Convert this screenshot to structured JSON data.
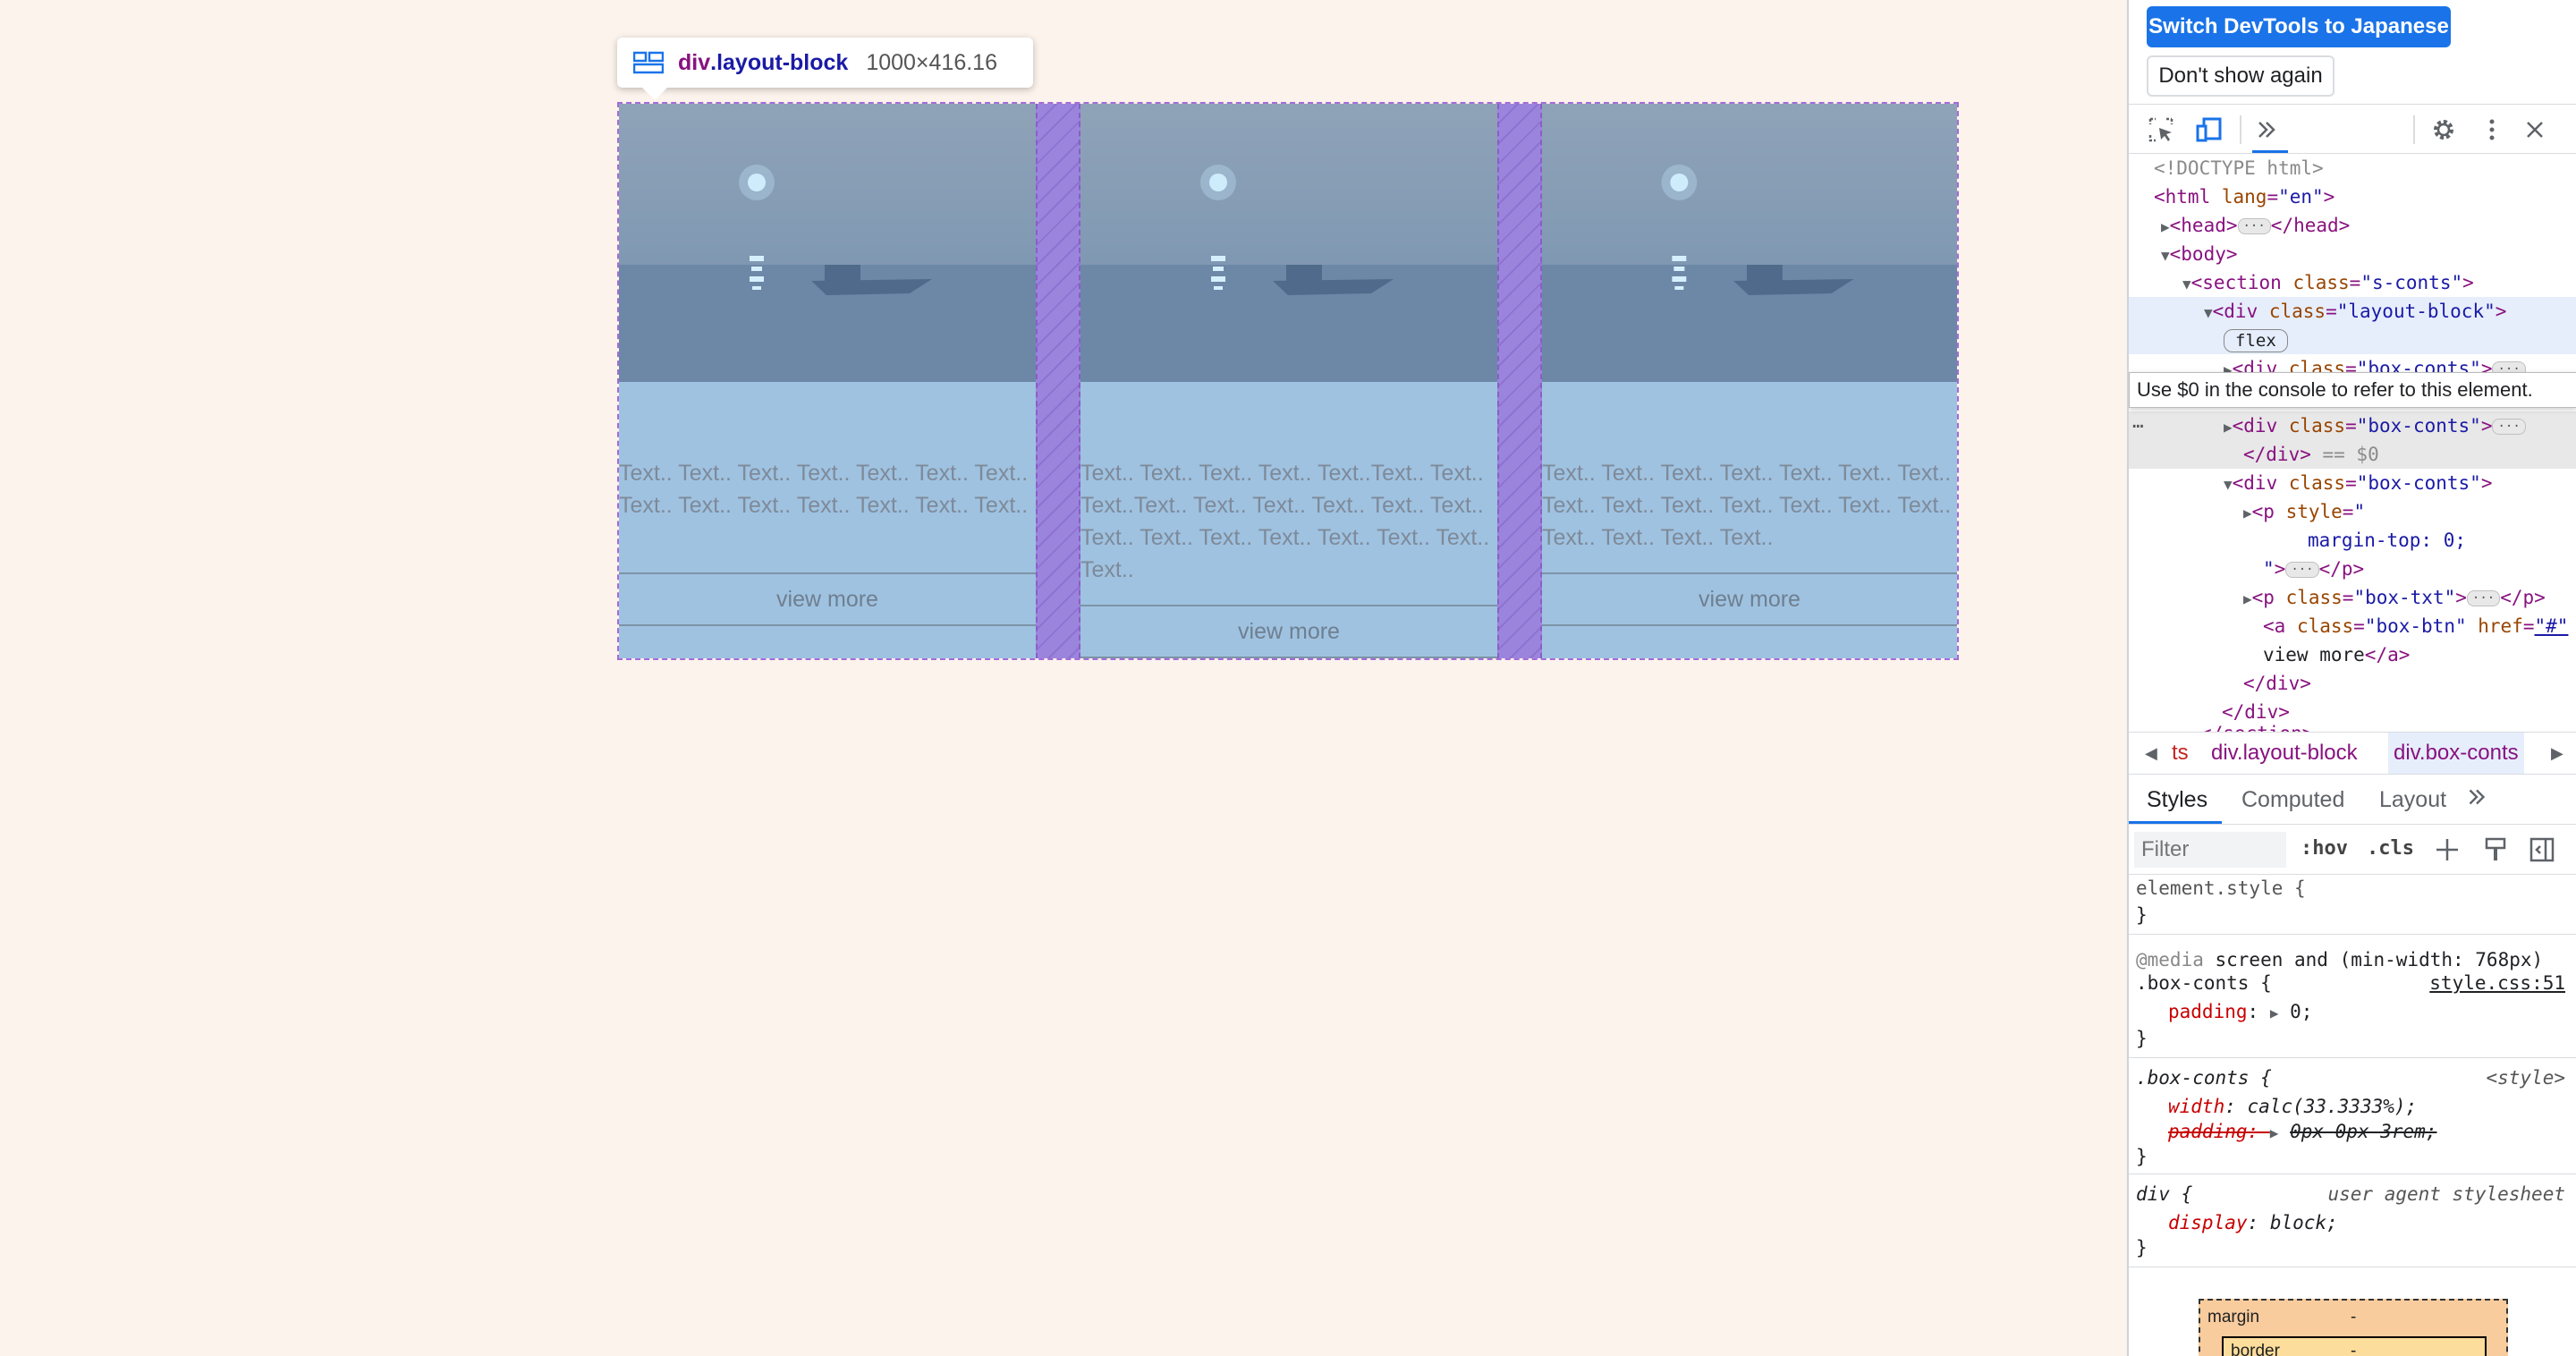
{
  "tooltip": {
    "tag": "div",
    "class": ".layout-block",
    "size": "1000×416.16"
  },
  "boxes": [
    {
      "text": "Text.. Text.. Text.. Text.. Text.. Text.. Text.. Text.. Text.. Text.. Text.. Text.. Text.. Text..",
      "button": "view more"
    },
    {
      "text": "Text.. Text.. Text.. Text.. Text..Text.. Text.. Text..Text.. Text.. Text.. Text.. Text.. Text.. Text.. Text.. Text.. Text.. Text.. Text.. Text.. Text..",
      "button": "view more"
    },
    {
      "text": "Text.. Text.. Text.. Text.. Text.. Text.. Text.. Text.. Text.. Text.. Text.. Text.. Text.. Text.. Text.. Text.. Text.. Text..",
      "button": "view more"
    }
  ],
  "devtools": {
    "switch_button": "Switch DevTools to Japanese",
    "dont_show_button": "Don't show again",
    "console_tip": "Use $0 in the console to refer to this element.",
    "flex_badge": "flex",
    "dom": {
      "doctype": "<!DOCTYPE html>",
      "html_open": "<html ",
      "html_attr": "lang",
      "html_val": "\"en\"",
      "html_close": ">",
      "head_open": "<head>",
      "head_close": "</head>",
      "body": "<body>",
      "section_open": "<section ",
      "class_attr": "class",
      "section_val": "\"s-conts\"",
      "div_open": "<div ",
      "layout_val": "\"layout-block\"",
      "boxconts_val": "\"box-conts\"",
      "div_close": "</div>",
      "eq0": " == $0",
      "p_open": "<p ",
      "style_attr": "style",
      "style_q": "\"",
      "margin_line": "margin-top: 0;",
      "p_close": "</p>",
      "boxtxt_val": "\"box-txt\"",
      "a_open": "<a ",
      "boxbtn_val": "\"box-btn\"",
      "href_attr": "href",
      "href_val": "\"#\"",
      "a_text": "view more",
      "a_close": "</a>",
      "section_close": "</section>",
      "gt": ">"
    },
    "crumbs": [
      "ts",
      "div.layout-block",
      "div.box-conts"
    ],
    "tabs": [
      "Styles",
      "Computed",
      "Layout"
    ],
    "filter_placeholder": "Filter",
    "hov": ":hov",
    "cls": ".cls",
    "styles": {
      "element_style": "element.style {",
      "close_brace": "}",
      "media_kw": "@media",
      "media_rest": " screen and (min-width: 768px)",
      "box_conts_sel": ".box-conts {",
      "source1": "style.css:51",
      "padding_prop": "padding",
      "padding_val": "0;",
      "source2": "<style>",
      "width_prop": "width",
      "width_val": "calc(33.3333%);",
      "padding_old": "padding: ",
      "padding_old_val": "0px 0px 3rem;",
      "div_sel": "div {",
      "ua": "user agent stylesheet",
      "display_prop": "display",
      "display_val": "block;"
    },
    "boxmodel": {
      "margin": "margin",
      "border": "border",
      "dash": "-"
    }
  }
}
